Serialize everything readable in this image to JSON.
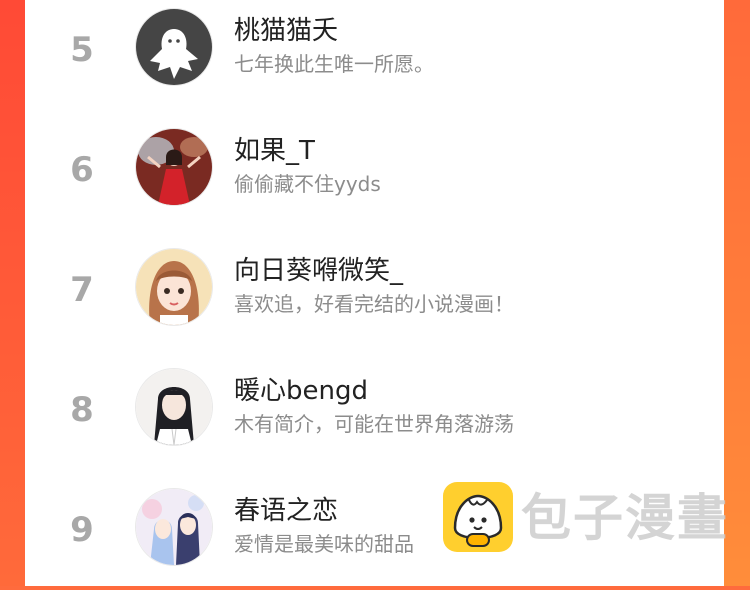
{
  "ranking": [
    {
      "rank": "5",
      "name": "桃猫猫夭",
      "bio": "七年换此生唯一所愿。"
    },
    {
      "rank": "6",
      "name": "如果_T",
      "bio": "偷偷藏不住yyds"
    },
    {
      "rank": "7",
      "name": "向日葵嘚微笑_",
      "bio": "喜欢追，好看完结的小说漫画！"
    },
    {
      "rank": "8",
      "name": "暖心bengd",
      "bio": "木有简介，可能在世界角落游荡"
    },
    {
      "rank": "9",
      "name": "春语之恋",
      "bio": "爱情是最美味的甜品"
    }
  ],
  "watermark": {
    "text": "包子漫畫",
    "logo_icon": "bun-logo-icon"
  },
  "colors": {
    "accent_left": "#ff4a36",
    "accent_right": "#ff8d3a",
    "rank": "#a8a8a8"
  }
}
